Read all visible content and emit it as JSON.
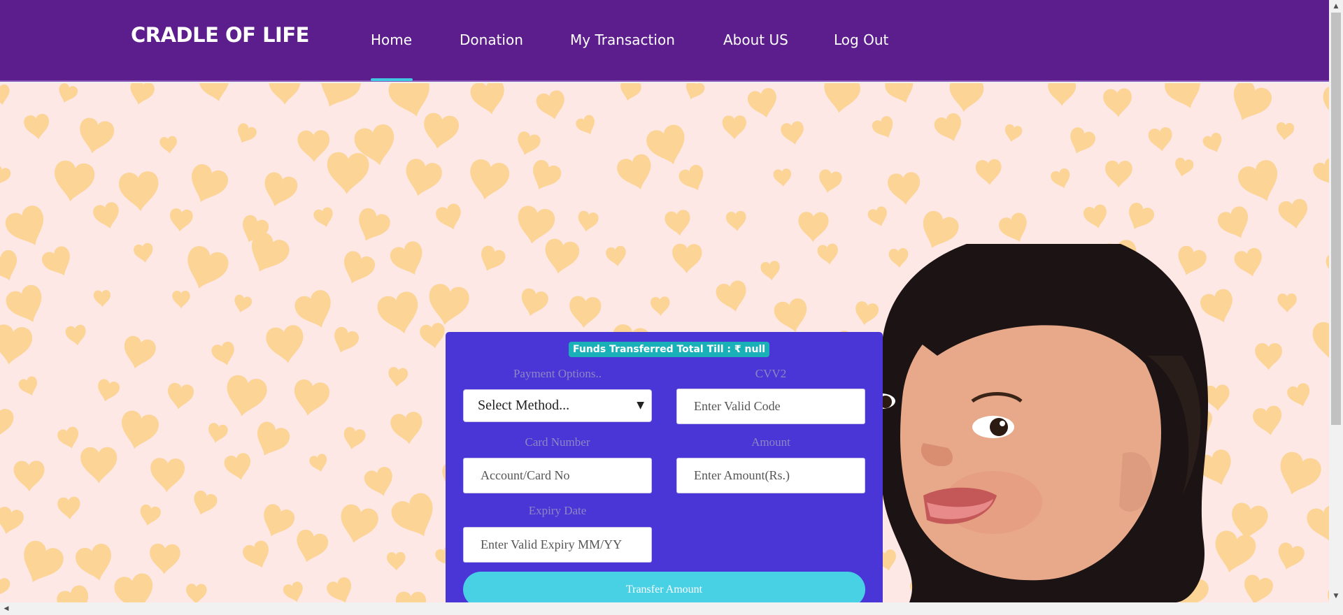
{
  "navbar": {
    "brand": "CRADLE OF LIFE",
    "links": [
      "Home",
      "Donation",
      "My Transaction",
      "About US",
      "Log Out"
    ],
    "active_link": "Home",
    "background": "#5c1e8c",
    "accent": "#40c8e0"
  },
  "form": {
    "funds_badge": "Funds Transferred Total Till : ₹ null",
    "payment_label": "Payment Options..",
    "payment_select": "Select Method...",
    "cvv_label": "CVV2",
    "cvv_placeholder": "Enter Valid Code",
    "card_label": "Card Number",
    "card_placeholder": "Account/Card No",
    "amount_label": "Amount",
    "amount_placeholder": "Enter Amount(Rs.)",
    "expiry_label": "Expiry Date",
    "expiry_placeholder": "Enter Valid Expiry MM/YY",
    "submit_label": "Transfer Amount",
    "card_color": "#4a36d6",
    "button_color": "#48d0e4"
  },
  "icons": {
    "select_chevron": "chevron-down-icon",
    "scroll_up": "scroll-up-arrow-icon",
    "scroll_down": "scroll-down-arrow-icon",
    "scroll_left": "scroll-left-arrow-icon"
  }
}
